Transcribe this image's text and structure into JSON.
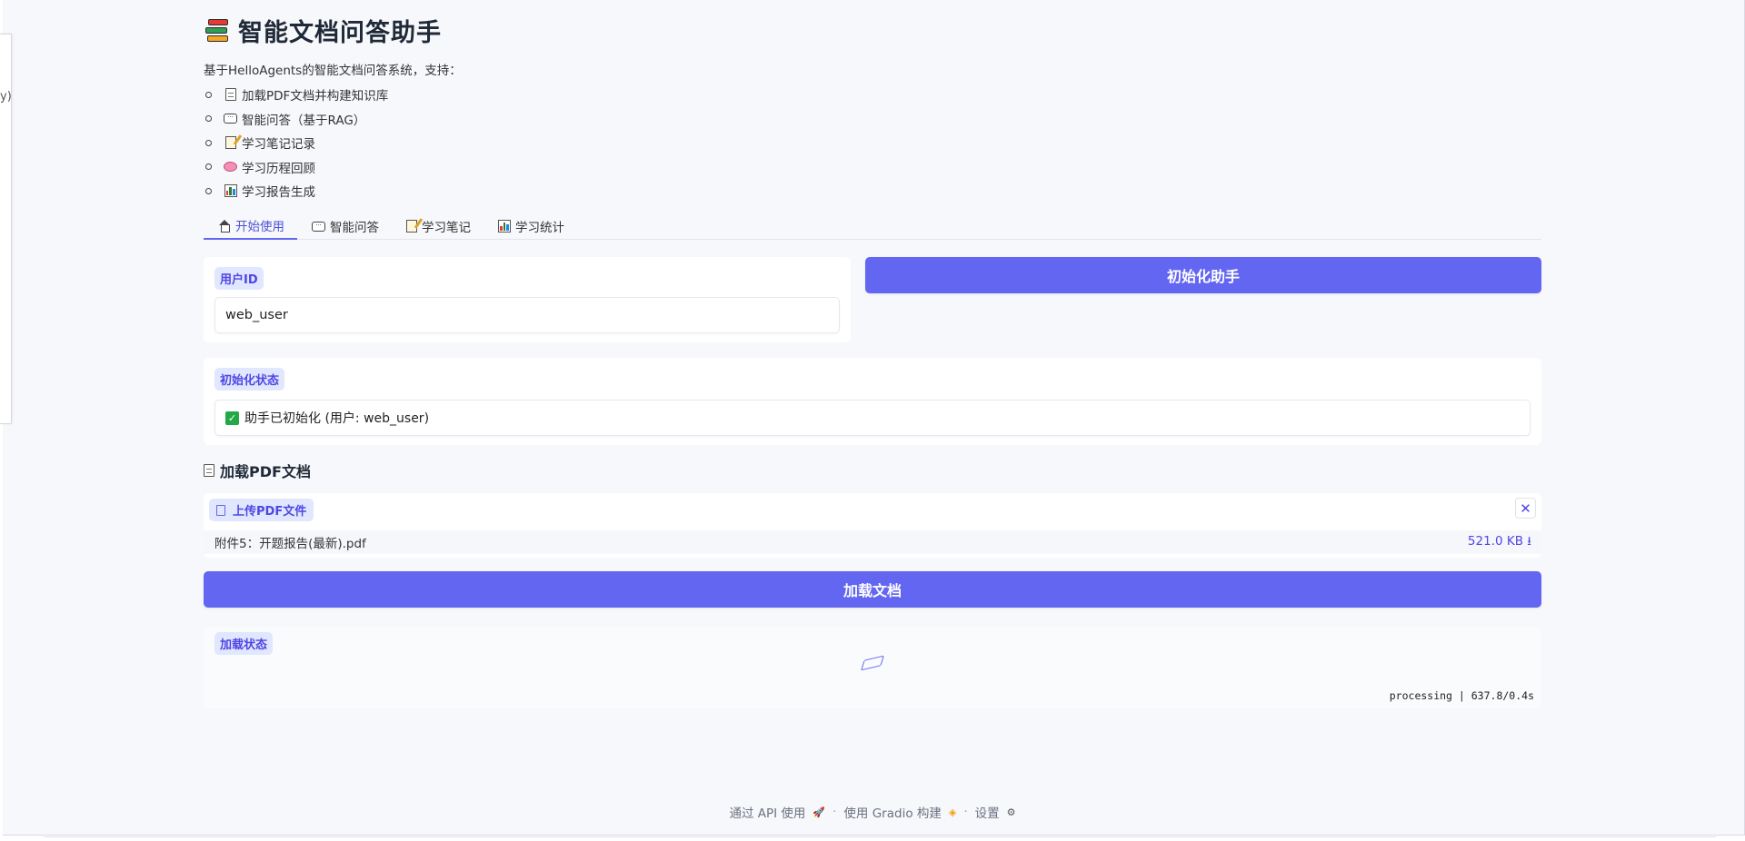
{
  "app": {
    "title": "智能文档问答助手",
    "title_icon": "books-icon",
    "intro": "基于HelloAgents的智能文档问答系统，支持：",
    "side_panel_text": "y)"
  },
  "features": [
    {
      "icon": "document-icon",
      "label": "加载PDF文档并构建知识库"
    },
    {
      "icon": "speech-bubble-icon",
      "label": "智能问答（基于RAG）"
    },
    {
      "icon": "memo-icon",
      "label": "学习笔记记录"
    },
    {
      "icon": "brain-icon",
      "label": "学习历程回顾"
    },
    {
      "icon": "bar-chart-icon",
      "label": "学习报告生成"
    }
  ],
  "tabs": [
    {
      "icon": "house-icon",
      "label": "开始使用",
      "active": true
    },
    {
      "icon": "speech-bubble-icon",
      "label": "智能问答",
      "active": false
    },
    {
      "icon": "memo-icon",
      "label": "学习笔记",
      "active": false
    },
    {
      "icon": "bar-chart-icon",
      "label": "学习统计",
      "active": false
    }
  ],
  "user_id": {
    "label": "用户ID",
    "value": "web_user"
  },
  "init_button": {
    "label": "初始化助手"
  },
  "init_status": {
    "label": "初始化状态",
    "value": "助手已初始化 (用户: web_user)",
    "icon": "check-mark-icon"
  },
  "load_section": {
    "heading": "加载PDF文档",
    "upload_label": "上传PDF文件",
    "file_name": "附件5：开题报告(最新).pdf",
    "file_size": "521.0 KB ⭳",
    "load_button": "加载文档"
  },
  "load_status": {
    "label": "加载状态",
    "progress": "processing | 637.8/0.4s"
  },
  "footer": {
    "api": "通过 API 使用",
    "built": "使用 Gradio 构建",
    "settings": "设置",
    "separator": "·"
  },
  "colors": {
    "accent": "#6366f1",
    "chip_bg": "#e0e7ff",
    "chip_text": "#4f46e5",
    "success": "#22a846",
    "page_bg": "#f7f8fb"
  }
}
